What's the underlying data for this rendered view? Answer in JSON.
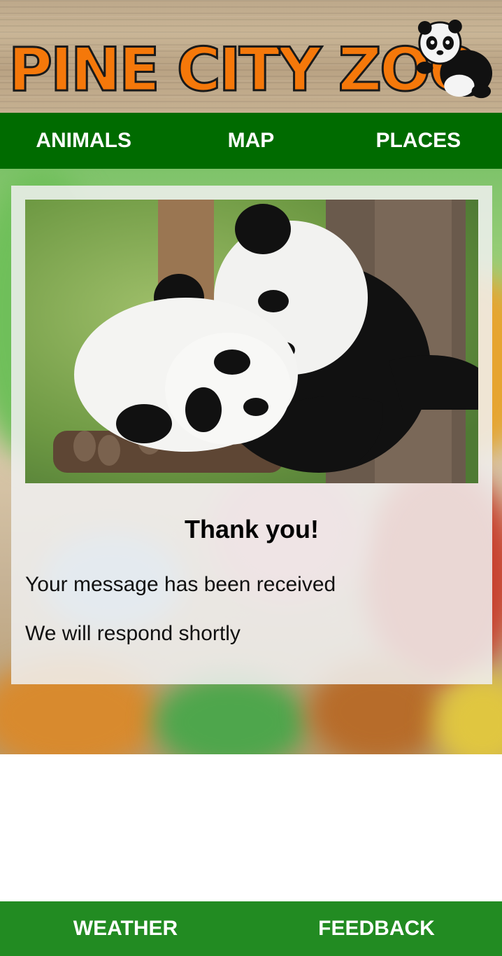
{
  "header": {
    "logo_text": "PINE CITY ZOO",
    "logo_icon": "panda-icon",
    "logo_color": "#f5780a"
  },
  "topnav": {
    "items": [
      {
        "label": "ANIMALS"
      },
      {
        "label": "MAP"
      },
      {
        "label": "PLACES"
      }
    ],
    "color": "#006b00"
  },
  "card": {
    "image": "two-pandas-photo",
    "title": "Thank you!",
    "lines": [
      "Your message has been received",
      "We will respond shortly"
    ]
  },
  "bottomnav": {
    "items": [
      {
        "label": "WEATHER"
      },
      {
        "label": "FEEDBACK"
      }
    ],
    "color": "#228b22"
  }
}
